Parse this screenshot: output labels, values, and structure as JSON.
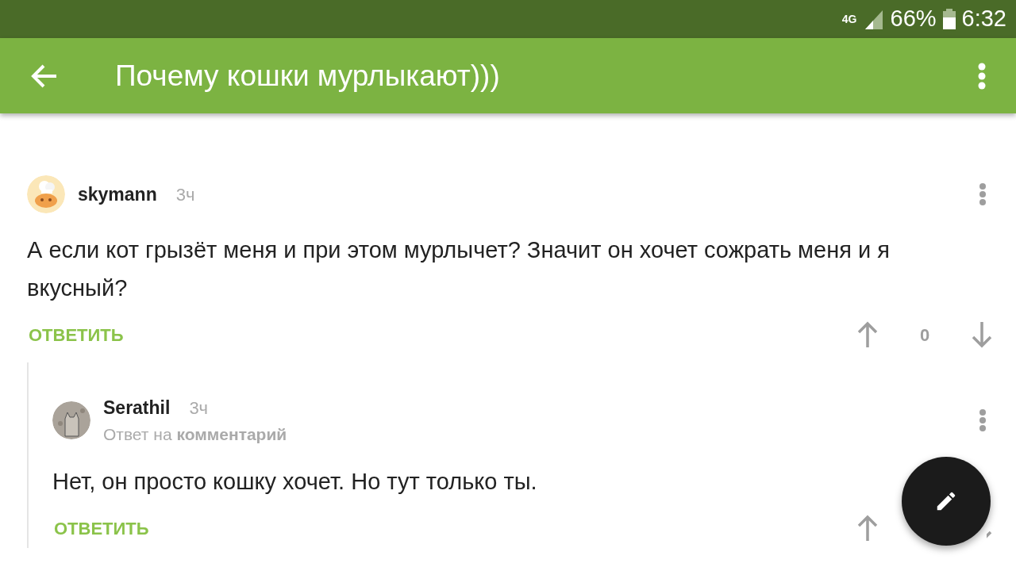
{
  "status_bar": {
    "network": "4G",
    "battery": "66%",
    "time": "6:32"
  },
  "app_bar": {
    "title": "Почему кошки мурлыкают)))"
  },
  "comments": [
    {
      "author": "skymann",
      "time": "3ч",
      "text": "А если кот грызёт меня и при этом мурлычет? Значит он хочет сожрать меня и я вкусный?",
      "reply_label": "ОТВЕТИТЬ",
      "score": "0",
      "children": [
        {
          "author": "Serathil",
          "time": "3ч",
          "reply_to": "Ответ на **комментарий**",
          "text": "Нет, он просто кошку хочет. Но тут только ты.",
          "reply_label": "ОТВЕТИТЬ"
        }
      ]
    }
  ]
}
